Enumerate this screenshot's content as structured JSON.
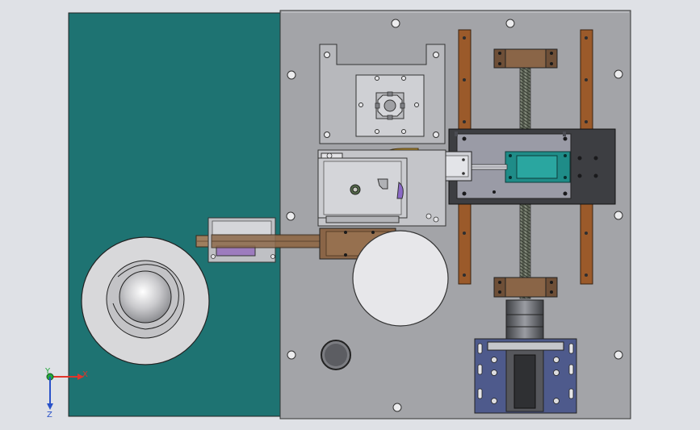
{
  "viewport": {
    "kind": "cad-assembly-top-view",
    "background": "#dfe1e6",
    "colors": {
      "green_panel": "#1e7372",
      "base_plate": "#a3a4a8",
      "sub_plate": "#c9cace",
      "dark_block": "#3d3e42",
      "bronze": "#8a6547",
      "copper_rail": "#9b5a2a",
      "teal_block": "#1f8c88",
      "gold_part": "#c79a2a",
      "motor_blue": "#4e5a8c",
      "disc": "#d8d8da"
    }
  },
  "triad": {
    "x_label": "X",
    "y_label": "Y",
    "z_label": "Z",
    "x_color": "#e0352b",
    "y_color": "#22a73a",
    "z_color": "#2a52c9"
  }
}
